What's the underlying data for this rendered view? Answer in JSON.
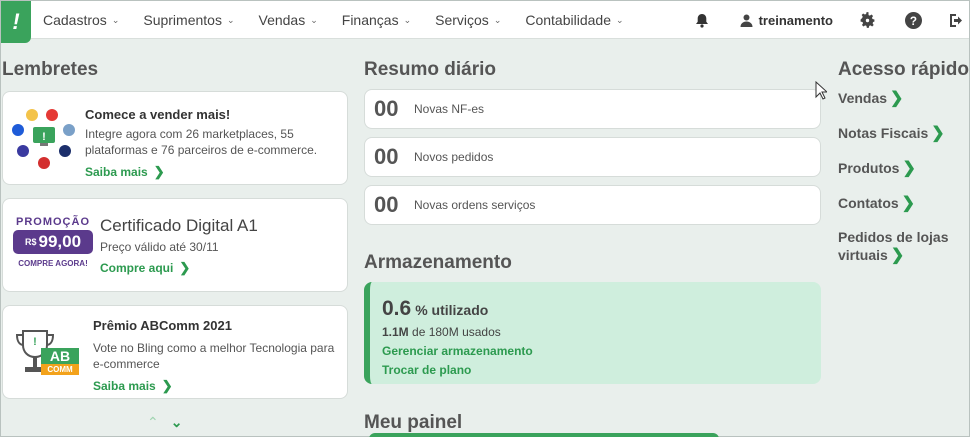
{
  "topbar": {
    "logo": "!",
    "menu": [
      "Cadastros",
      "Suprimentos",
      "Vendas",
      "Finanças",
      "Serviços",
      "Contabilidade"
    ],
    "username": "treinamento",
    "icons": [
      "bell-icon",
      "user-icon",
      "gear-icon",
      "help-icon",
      "logout-icon"
    ]
  },
  "reminders": {
    "title": "Lembretes",
    "card1": {
      "title": "Comece a vender mais!",
      "text": "Integre agora com 26 marketplaces, 55 plataformas e 76 parceiros de e-commerce.",
      "link": "Saiba mais"
    },
    "card2": {
      "promo_label": "PROMOÇÃO",
      "currency": "R$",
      "price": "99,00",
      "promo_cta": "COMPRE AGORA!",
      "title": "Certificado Digital A1",
      "text": "Preço válido até 30/11",
      "link": "Compre aqui"
    },
    "card3": {
      "title": "Prêmio ABComm 2021",
      "text": "Vote no Bling como a melhor Tecnologia para e-commerce",
      "link": "Saiba mais",
      "logo_ab": "AB",
      "logo_comm": "COMM"
    }
  },
  "summary": {
    "title": "Resumo diário",
    "items": [
      {
        "value": "00",
        "label": "Novas NF-es"
      },
      {
        "value": "00",
        "label": "Novos pedidos"
      },
      {
        "value": "00",
        "label": "Novas ordens serviços"
      }
    ]
  },
  "storage": {
    "title": "Armazenamento",
    "percent": "0.6",
    "percent_label": "% utilizado",
    "used": "1.1M",
    "used_suffix": "de 180M usados",
    "manage_link": "Gerenciar armazenamento",
    "plan_link": "Trocar de plano"
  },
  "panel": {
    "title": "Meu painel"
  },
  "quick_access": {
    "title": "Acesso rápido",
    "items": [
      "Vendas",
      "Notas Fiscais",
      "Produtos",
      "Contatos",
      "Pedidos de lojas virtuais"
    ]
  },
  "colors": {
    "accent": "#3aa35c",
    "link": "#2c9a4f",
    "background": "#e9efec",
    "promo": "#5b3a8c"
  }
}
